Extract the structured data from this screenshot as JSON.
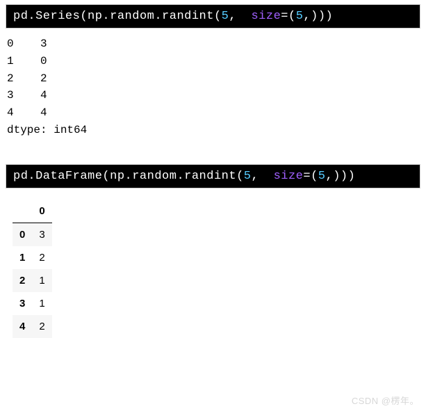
{
  "cell1": {
    "code": {
      "t1": "pd.Series",
      "p1": "(",
      "t2": "np.random.randint",
      "p2": "(",
      "n1": "5",
      "c1": ",  ",
      "kw": "size",
      "eq": "=",
      "p3": "(",
      "n2": "5",
      "c2": ",",
      "p4": ")",
      "p5": ")",
      "p6": ")"
    },
    "output_lines": [
      "0    3",
      "1    0",
      "2    2",
      "3    4",
      "4    4",
      "dtype: int64"
    ]
  },
  "cell2": {
    "code": {
      "t1": "pd.DataFrame",
      "p1": "(",
      "t2": "np.random.randint",
      "p2": "(",
      "n1": "5",
      "c1": ",  ",
      "kw": "size",
      "eq": "=",
      "p3": "(",
      "n2": "5",
      "c2": ",",
      "p4": ")",
      "p5": ")",
      "p6": ")"
    },
    "dataframe": {
      "columns": [
        "0"
      ],
      "index": [
        "0",
        "1",
        "2",
        "3",
        "4"
      ],
      "rows": [
        [
          "3"
        ],
        [
          "2"
        ],
        [
          "1"
        ],
        [
          "1"
        ],
        [
          "2"
        ]
      ]
    }
  },
  "watermark": "CSDN @楞年。"
}
